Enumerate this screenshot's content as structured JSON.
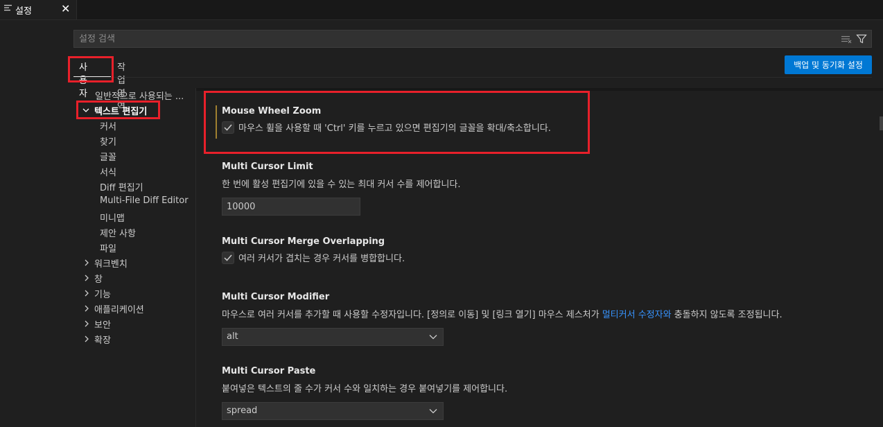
{
  "tab": {
    "label": "설정",
    "close": "✕"
  },
  "search": {
    "placeholder": "설정 검색"
  },
  "scope": {
    "user": "사용자",
    "workspace": "작업 영역"
  },
  "sync_button": "백업 및 동기화 설정",
  "toc": {
    "common": "일반적으로 사용되는 ...",
    "text_editor": "텍스트 편집기",
    "children": [
      "커서",
      "찾기",
      "글꼴",
      "서식",
      "Diff 편집기",
      "Multi-File Diff Editor",
      "미니맵",
      "제안 사항",
      "파일"
    ],
    "groups": [
      "워크벤치",
      "창",
      "기능",
      "애플리케이션",
      "보안",
      "확장"
    ]
  },
  "settings": {
    "mouse_wheel_zoom": {
      "title": "Mouse Wheel Zoom",
      "checkbox_label": "마우스 휠을 사용할 때 'Ctrl' 키를 누르고 있으면 편집기의 글꼴을 확대/축소합니다.",
      "checked": true
    },
    "multi_cursor_limit": {
      "title": "Multi Cursor Limit",
      "description": "한 번에 활성 편집기에 있을 수 있는 최대 커서 수를 제어합니다.",
      "value": "10000"
    },
    "multi_cursor_merge": {
      "title": "Multi Cursor Merge Overlapping",
      "checkbox_label": "여러 커서가 겹치는 경우 커서를 병합합니다.",
      "checked": true
    },
    "multi_cursor_modifier": {
      "title": "Multi Cursor Modifier",
      "description_before": "마우스로 여러 커서를 추가할 때 사용할 수정자입니다. [정의로 이동] 및 [링크 열기] 마우스 제스처가 ",
      "description_link": "멀티커서 수정자와",
      "description_after": " 충돌하지 않도록 조정됩니다.",
      "value": "alt"
    },
    "multi_cursor_paste": {
      "title": "Multi Cursor Paste",
      "description": "붙여넣은 텍스트의 줄 수가 커서 수와 일치하는 경우 붙여넣기를 제어합니다.",
      "value": "spread"
    }
  },
  "colors": {
    "accent": "#0078d4",
    "highlight": "#e8202a",
    "link": "#3794ff"
  }
}
